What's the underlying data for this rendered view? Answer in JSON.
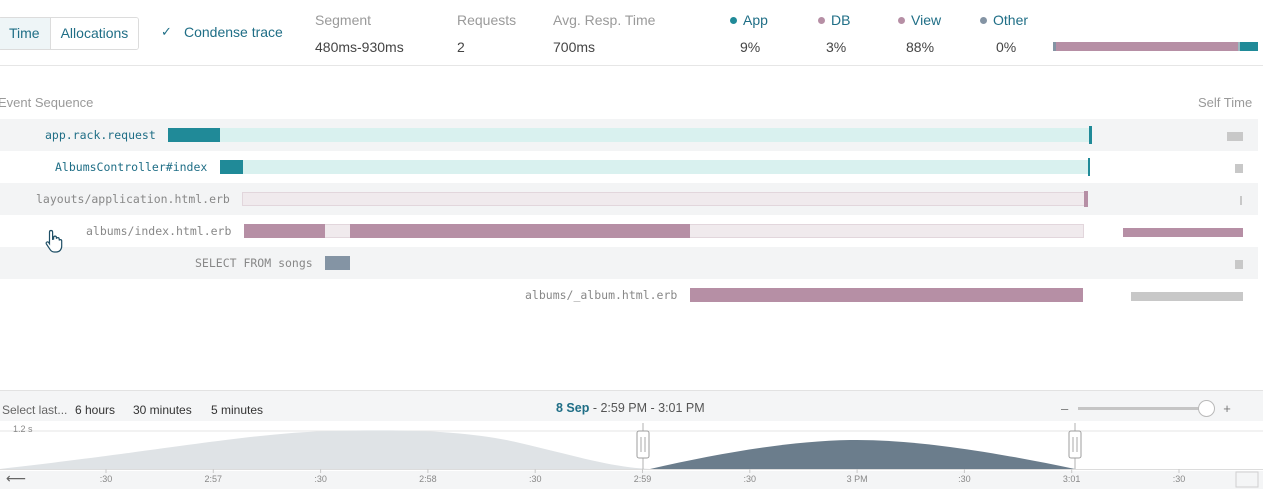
{
  "toggle": {
    "time": "Time",
    "allocations": "Allocations"
  },
  "condense": {
    "label": "Condense trace",
    "checked": true,
    "check_glyph": "✓"
  },
  "stats": {
    "segment": {
      "label": "Segment",
      "value": "480ms-930ms"
    },
    "requests": {
      "label": "Requests",
      "value": "2"
    },
    "avg": {
      "label": "Avg. Resp. Time",
      "value": "700ms"
    }
  },
  "categories": [
    {
      "label": "App",
      "value": "9%",
      "color": "#208a98"
    },
    {
      "label": "DB",
      "value": "3%",
      "color": "#b68fa5"
    },
    {
      "label": "View",
      "value": "88%",
      "color": "#b68fa5"
    },
    {
      "label": "Other",
      "value": "0%",
      "color": "#8494a4"
    }
  ],
  "trace": {
    "header_left": "Event Sequence",
    "header_right": "Self Time",
    "rows": [
      {
        "name": "app.rack.request"
      },
      {
        "name": "AlbumsController#index"
      },
      {
        "name": "layouts/application.html.erb"
      },
      {
        "name": "albums/index.html.erb"
      },
      {
        "name": "SELECT FROM songs"
      },
      {
        "name": "albums/_album.html.erb"
      }
    ]
  },
  "picker": {
    "select_last": "Select last...",
    "opt_6h": "6 hours",
    "opt_30m": "30 minutes",
    "opt_5m": "5 minutes",
    "date": "8 Sep",
    "range": " - 2:59 PM - 3:01 PM",
    "zoom_minus": "–",
    "zoom_plus": "+",
    "y_max": "1.2 s",
    "ticks": [
      ":30",
      "2:57",
      ":30",
      "2:58",
      ":30",
      "2:59",
      ":30",
      "3 PM",
      ":30",
      "3:01",
      ":30"
    ],
    "back_arrow": "⟵"
  }
}
